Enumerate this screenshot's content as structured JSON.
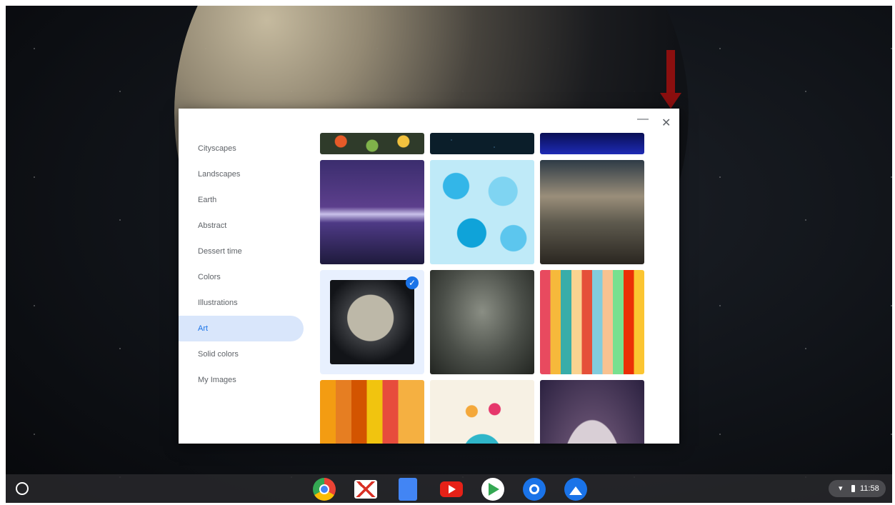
{
  "window": {
    "minimize_glyph": "—",
    "close_glyph": "✕"
  },
  "sidebar": {
    "items": [
      {
        "label": "Cityscapes",
        "active": false
      },
      {
        "label": "Landscapes",
        "active": false
      },
      {
        "label": "Earth",
        "active": false
      },
      {
        "label": "Abstract",
        "active": false
      },
      {
        "label": "Dessert time",
        "active": false
      },
      {
        "label": "Colors",
        "active": false
      },
      {
        "label": "Illustrations",
        "active": false
      },
      {
        "label": "Art",
        "active": true
      },
      {
        "label": "Solid colors",
        "active": false
      },
      {
        "label": "My Images",
        "active": false
      }
    ]
  },
  "wallpapers": {
    "selected_check": "✓",
    "tiles": [
      {
        "name": "colorful-dots-art",
        "selected": false
      },
      {
        "name": "night-sky-dots",
        "selected": false
      },
      {
        "name": "blue-horizon",
        "selected": false
      },
      {
        "name": "purple-mountains",
        "selected": false
      },
      {
        "name": "blue-cloud-pattern",
        "selected": false
      },
      {
        "name": "tree-cloudy-sky",
        "selected": false
      },
      {
        "name": "moon-night",
        "selected": true
      },
      {
        "name": "floating-boat",
        "selected": false
      },
      {
        "name": "color-stripes",
        "selected": false
      },
      {
        "name": "geometric-mountains",
        "selected": false
      },
      {
        "name": "colorful-deer",
        "selected": false
      },
      {
        "name": "giraffe-planet",
        "selected": false
      }
    ]
  },
  "colors": {
    "accent": "#1a73e8",
    "selected_bg": "#d9e6fb",
    "annotation_arrow": "#8b0f0f"
  },
  "shelf": {
    "apps": [
      "chrome-icon",
      "gmail-icon",
      "docs-icon",
      "youtube-icon",
      "play-store-icon",
      "settings-icon",
      "photos-icon"
    ],
    "time": "11:58"
  }
}
